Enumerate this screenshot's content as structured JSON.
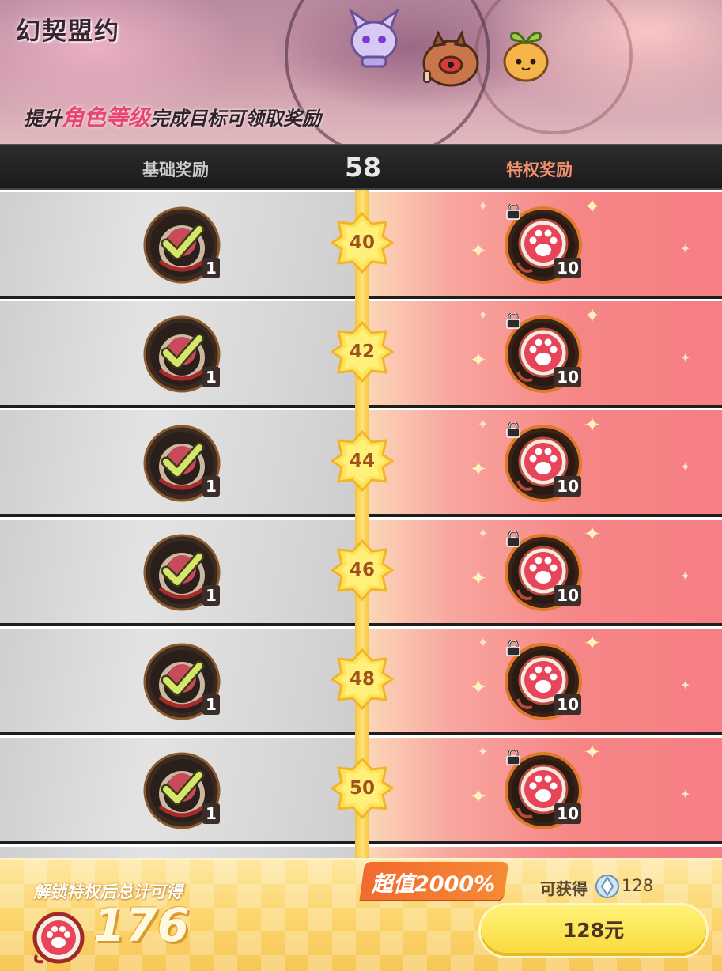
{
  "banner": {
    "title": "幻契盟约",
    "subtitle_pre": "提升",
    "subtitle_highlight": "角色等级",
    "subtitle_post": "完成目标可领取奖励"
  },
  "tabs": {
    "basic_label": "基础奖励",
    "current_level": "58",
    "premium_label": "特权奖励"
  },
  "rows": [
    {
      "level": "40",
      "basic_qty": "1",
      "premium_qty": "10"
    },
    {
      "level": "42",
      "basic_qty": "1",
      "premium_qty": "10"
    },
    {
      "level": "44",
      "basic_qty": "1",
      "premium_qty": "10"
    },
    {
      "level": "46",
      "basic_qty": "1",
      "premium_qty": "10"
    },
    {
      "level": "48",
      "basic_qty": "1",
      "premium_qty": "10"
    },
    {
      "level": "50",
      "basic_qty": "1",
      "premium_qty": "10"
    }
  ],
  "footer": {
    "unlock_label": "解锁特权后总计可得",
    "total": "176",
    "deal": "超值2000%",
    "obtain_label": "可获得",
    "obtain_count": "128",
    "price_button": "128元"
  },
  "colors": {
    "premium_accent": "#f0906f",
    "highlight": "#e8466e",
    "track": "#f5c33a",
    "button": "#f9d93a"
  }
}
